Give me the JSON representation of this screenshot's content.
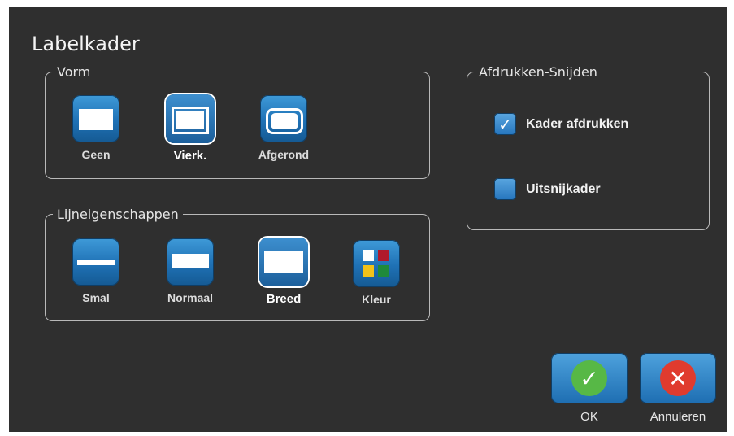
{
  "dialog": {
    "title": "Labelkader"
  },
  "vorm": {
    "legend": "Vorm",
    "options": [
      {
        "label": "Geen",
        "icon": "no-frame-icon",
        "selected": false
      },
      {
        "label": "Vierk.",
        "icon": "square-frame-icon",
        "selected": true
      },
      {
        "label": "Afgerond",
        "icon": "rounded-frame-icon",
        "selected": false
      }
    ]
  },
  "lijn": {
    "legend": "Lijneigenschappen",
    "options": [
      {
        "label": "Smal",
        "icon": "narrow-line-icon",
        "selected": false
      },
      {
        "label": "Normaal",
        "icon": "normal-line-icon",
        "selected": false
      },
      {
        "label": "Breed",
        "icon": "wide-line-icon",
        "selected": true
      },
      {
        "label": "Kleur",
        "icon": "color-grid-icon",
        "selected": false
      }
    ],
    "color_swatches": [
      "#ffffff",
      "#b0192c",
      "#f2c21a",
      "#1f8a3b"
    ]
  },
  "afdrukken": {
    "legend": "Afdrukken-Snijden",
    "print_frame": {
      "label": "Kader afdrukken",
      "checked": true
    },
    "cut_frame": {
      "label": "Uitsnijkader",
      "checked": false
    }
  },
  "actions": {
    "ok": {
      "label": "OK",
      "icon": "check-icon",
      "color": "#57b846"
    },
    "cancel": {
      "label": "Annuleren",
      "icon": "close-icon",
      "color": "#e03b2e"
    }
  },
  "colors": {
    "background": "#2f2f2f",
    "accent": "#1f71b5"
  }
}
